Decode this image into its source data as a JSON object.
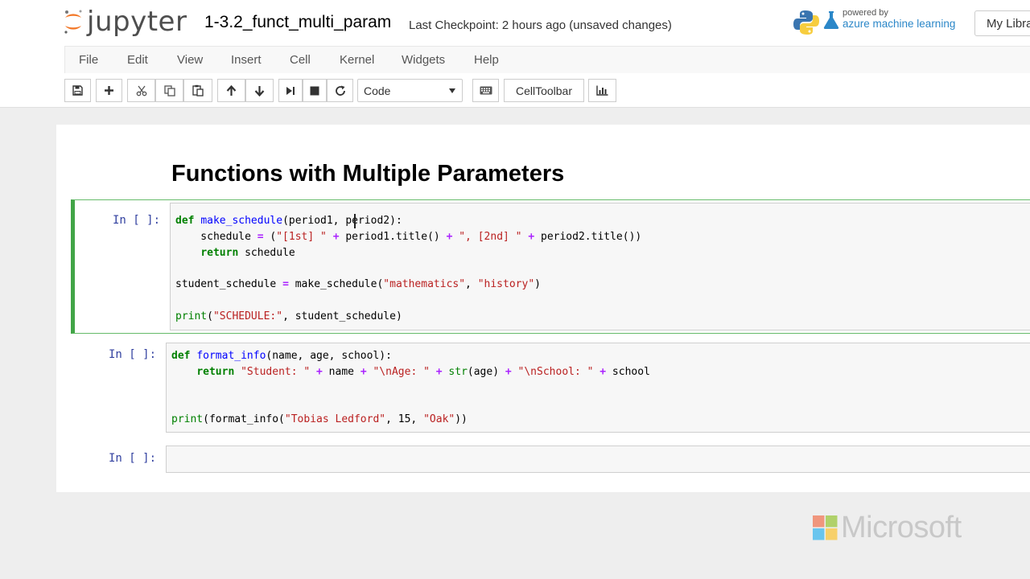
{
  "header": {
    "logo_text": "jupyter",
    "notebook_name": "1-3.2_funct_multi_param",
    "checkpoint": "Last Checkpoint: 2 hours ago (unsaved changes)",
    "powered_by": "powered by",
    "azure_ml": "azure machine learning",
    "library_button": "My Libra"
  },
  "menu": [
    "File",
    "Edit",
    "View",
    "Insert",
    "Cell",
    "Kernel",
    "Widgets",
    "Help"
  ],
  "toolbar": {
    "cell_type": "Code",
    "celltoolbar_label": "CellToolbar"
  },
  "notebook": {
    "heading": "Functions with Multiple Parameters",
    "cells": [
      {
        "prompt": "In [ ]:",
        "lines": [
          "def make_schedule(period1, period2):",
          "    schedule = (\"[1st] \" + period1.title() + \", [2nd] \" + period2.title())",
          "    return schedule",
          "",
          "student_schedule = make_schedule(\"mathematics\", \"history\")",
          "",
          "print(\"SCHEDULE:\", student_schedule)"
        ]
      },
      {
        "prompt": "In [ ]:",
        "lines": [
          "def format_info(name, age, school):",
          "    return \"Student: \" + name + \"\\nAge: \" + str(age) + \"\\nSchool: \" + school",
          "",
          "",
          "print(format_info(\"Tobias Ledford\", 15, \"Oak\"))"
        ]
      },
      {
        "prompt": "In [ ]:",
        "lines": []
      }
    ]
  },
  "watermark": "Microsoft",
  "colors": {
    "selected_cell_border": "#42a547",
    "prompt": "#303f9f",
    "keyword": "#008000",
    "string": "#ba2121"
  }
}
